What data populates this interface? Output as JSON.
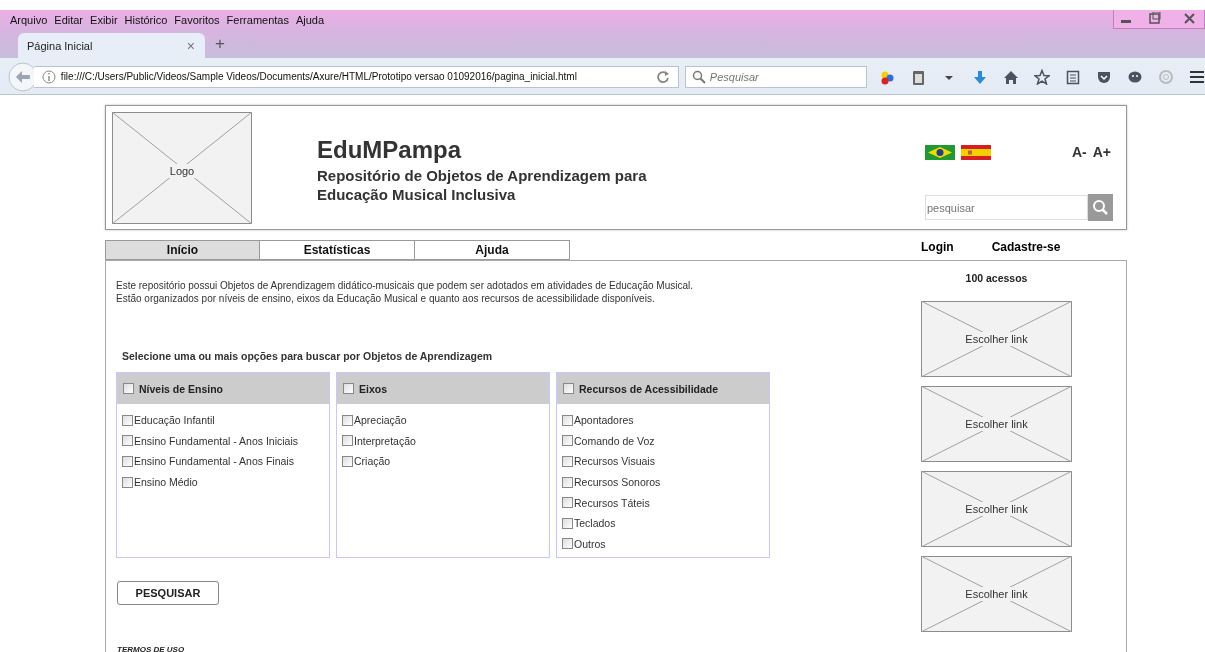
{
  "browser": {
    "menu": [
      "Arquivo",
      "Editar",
      "Exibir",
      "Histórico",
      "Favoritos",
      "Ferramentas",
      "Ajuda"
    ],
    "tab": {
      "title": "Página Inicial",
      "close": "×"
    },
    "new_tab": "+",
    "url": "file:///C:/Users/Public/Videos/Sample Videos/Documents/Axure/HTML/Prototipo versao 01092016/pagina_inicial.html",
    "search": {
      "placeholder": "Pesquisar"
    }
  },
  "header": {
    "logo_label": "Logo",
    "title": "EduMPampa",
    "subtitle": "Repositório de Objetos de Aprendizagem para Educação Musical Inclusiva",
    "font_controls": [
      "A-",
      "A+"
    ],
    "search": {
      "placeholder": "pesquisar"
    }
  },
  "nav_tabs": [
    {
      "label": "Início",
      "selected": true
    },
    {
      "label": "Estatísticas",
      "selected": false
    },
    {
      "label": "Ajuda",
      "selected": false
    }
  ],
  "account_links": [
    "Login",
    "Cadastre-se"
  ],
  "intro": [
    "Este repositório possui Objetos de Aprendizagem didático-musicais que podem ser adotados em atividades de Educação Musical.",
    "Estão organizados por níveis de ensino, eixos da Educação Musical e quanto aos recursos de acessibilidade disponíveis."
  ],
  "filter_prompt": "Selecione uma ou mais opções para buscar por Objetos de Aprendizagem",
  "filter_groups": [
    {
      "title": "Níveis de Ensino",
      "checked": false,
      "options": [
        {
          "label": "Educação Infantil",
          "checked": false
        },
        {
          "label": "Ensino Fundamental - Anos Iniciais",
          "checked": false
        },
        {
          "label": "Ensino Fundamental - Anos Finais",
          "checked": false
        },
        {
          "label": "Ensino Médio",
          "checked": false
        }
      ]
    },
    {
      "title": "Eixos",
      "checked": false,
      "options": [
        {
          "label": "Apreciação",
          "checked": false
        },
        {
          "label": "Interpretação",
          "checked": false
        },
        {
          "label": "Criação",
          "checked": false
        }
      ]
    },
    {
      "title": "Recursos de Acessibilidade",
      "checked": false,
      "options": [
        {
          "label": "Apontadores",
          "checked": false
        },
        {
          "label": "Comando de Voz",
          "checked": false
        },
        {
          "label": "Recursos Visuais",
          "checked": false
        },
        {
          "label": "Recursos Sonoros",
          "checked": false
        },
        {
          "label": "Recursos Táteis",
          "checked": false
        },
        {
          "label": "Teclados",
          "checked": false
        },
        {
          "label": "Outros",
          "checked": false
        }
      ]
    }
  ],
  "search_button": "PESQUISAR",
  "terms_link": "TERMOS DE USO",
  "sidebar": {
    "visits": "100 acessos",
    "link_placeholders": [
      "Escolher link",
      "Escolher link",
      "Escolher link",
      "Escolher link"
    ]
  }
}
